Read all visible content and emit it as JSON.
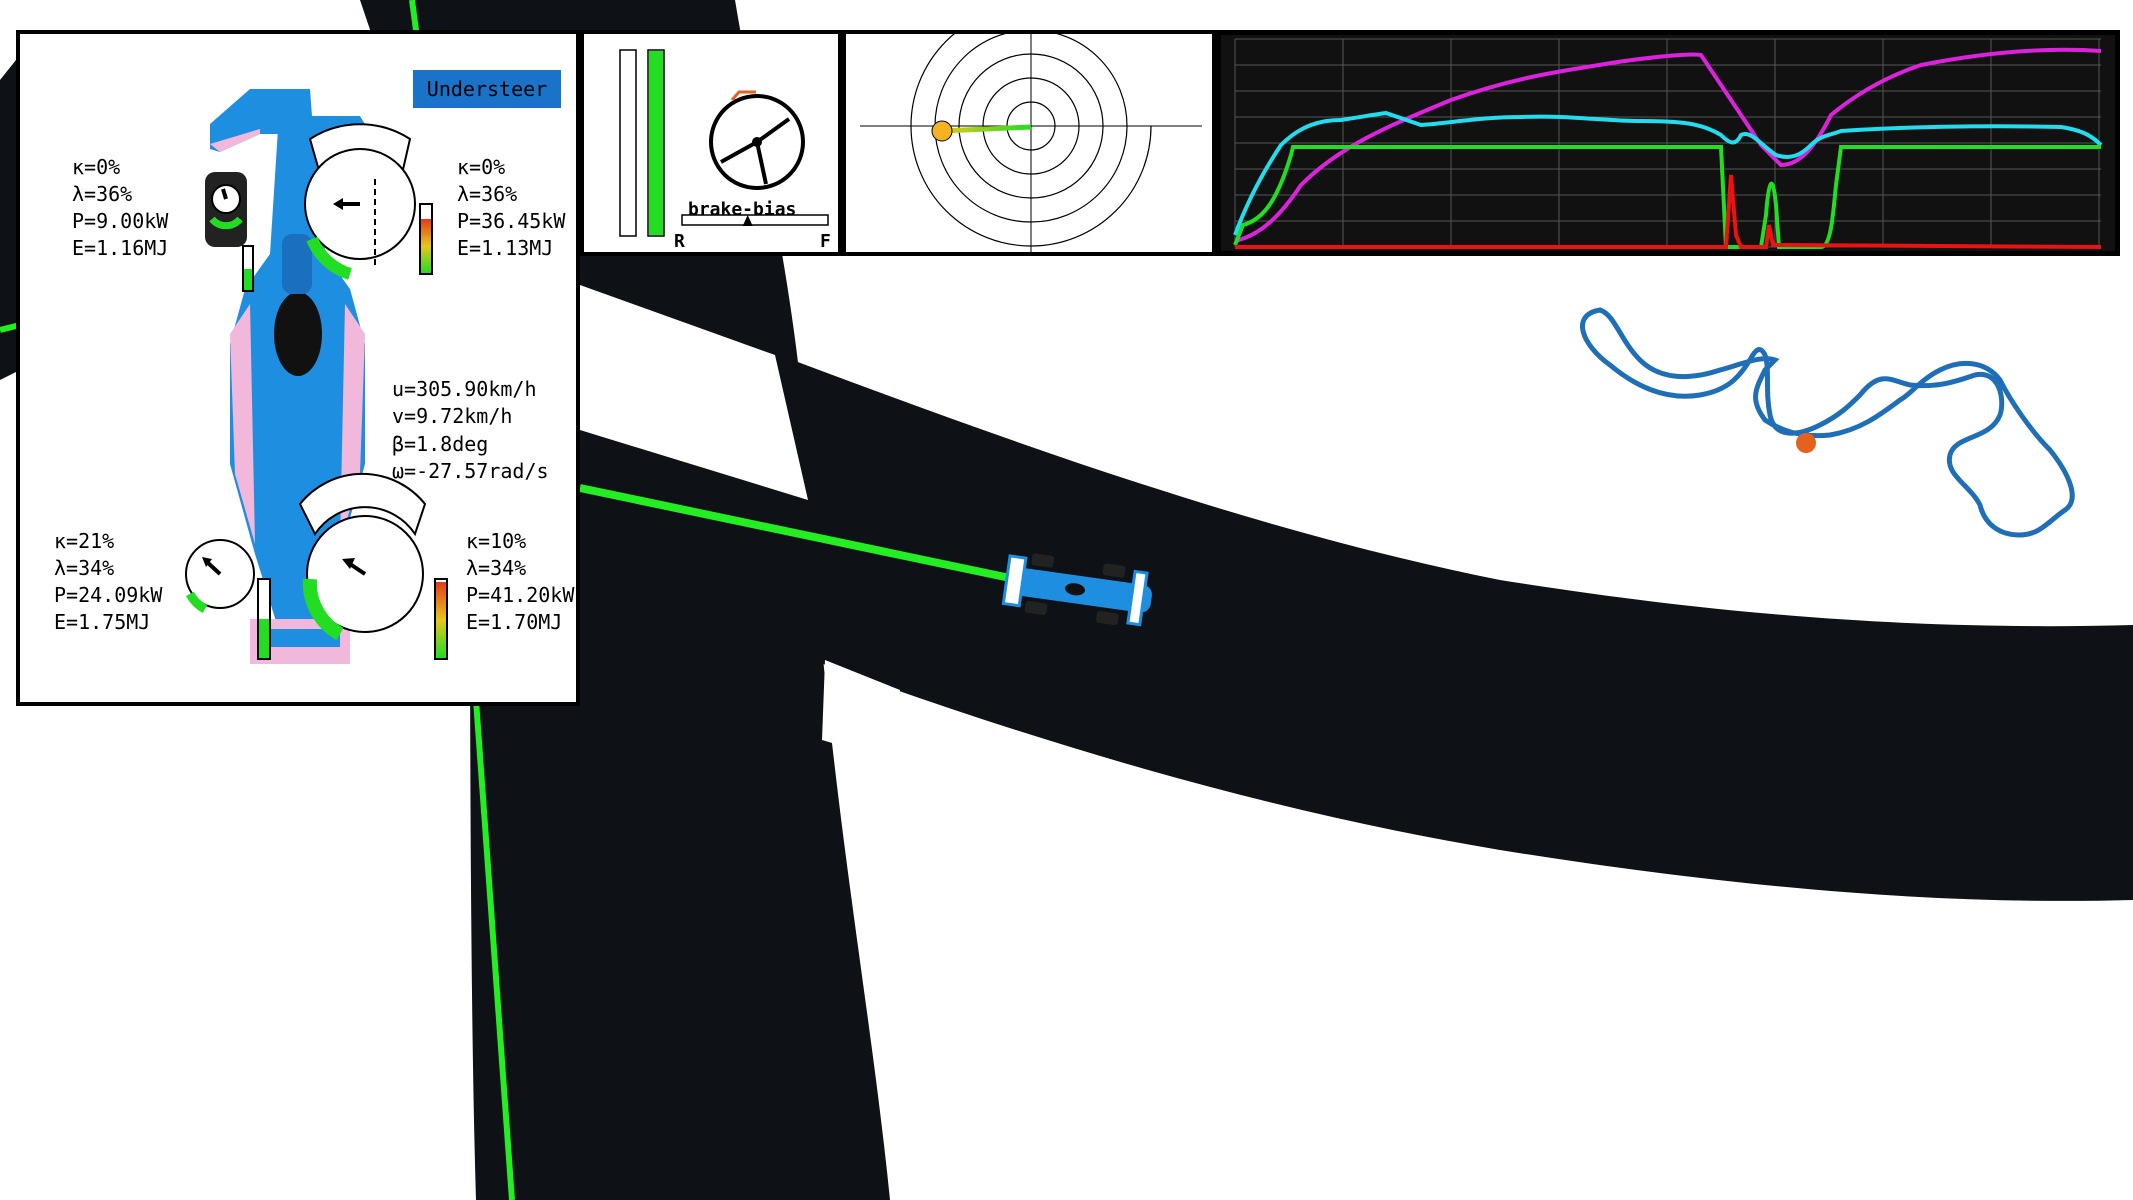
{
  "status": {
    "balance_label": "Understeer",
    "balance_color": "#1a73c8"
  },
  "tyres": {
    "front_left": {
      "kappa": "κ=0%",
      "lambda": "λ=36%",
      "power": "P=9.00kW",
      "energy": "E=1.16MJ"
    },
    "front_right": {
      "kappa": "κ=0%",
      "lambda": "λ=36%",
      "power": "P=36.45kW",
      "energy": "E=1.13MJ"
    },
    "rear_left": {
      "kappa": "κ=21%",
      "lambda": "λ=34%",
      "power": "P=24.09kW",
      "energy": "E=1.75MJ"
    },
    "rear_right": {
      "kappa": "κ=10%",
      "lambda": "λ=34%",
      "power": "P=41.20kW",
      "energy": "E=1.70MJ"
    }
  },
  "vehicle_state": {
    "u": "u=305.90km/h",
    "v": "v=9.72km/h",
    "beta": "β=1.8deg",
    "omega": "ω=-27.57rad/s"
  },
  "controls": {
    "brake_level": 0,
    "throttle_level": 1.0,
    "brake_bias_label": "brake-bias",
    "bias_rear_label": "R",
    "bias_front_label": "F",
    "bias_value": 0.45
  },
  "colors": {
    "throttle": "#22dd22",
    "speed": "#dd22dd",
    "lateral": "#22ddee",
    "brake": "#ee1111",
    "racing_line": "#22ee22",
    "track": "#0e1116",
    "map_line": "#1f6fb8",
    "map_marker": "#e4621e",
    "car_livery": "#1e8fe0"
  },
  "telemetry": {
    "series": [
      {
        "key": "speed",
        "color": "#dd22dd"
      },
      {
        "key": "lateral",
        "color": "#22ddee"
      },
      {
        "key": "throttle",
        "color": "#22dd22"
      },
      {
        "key": "brake",
        "color": "#ee1111"
      }
    ]
  }
}
